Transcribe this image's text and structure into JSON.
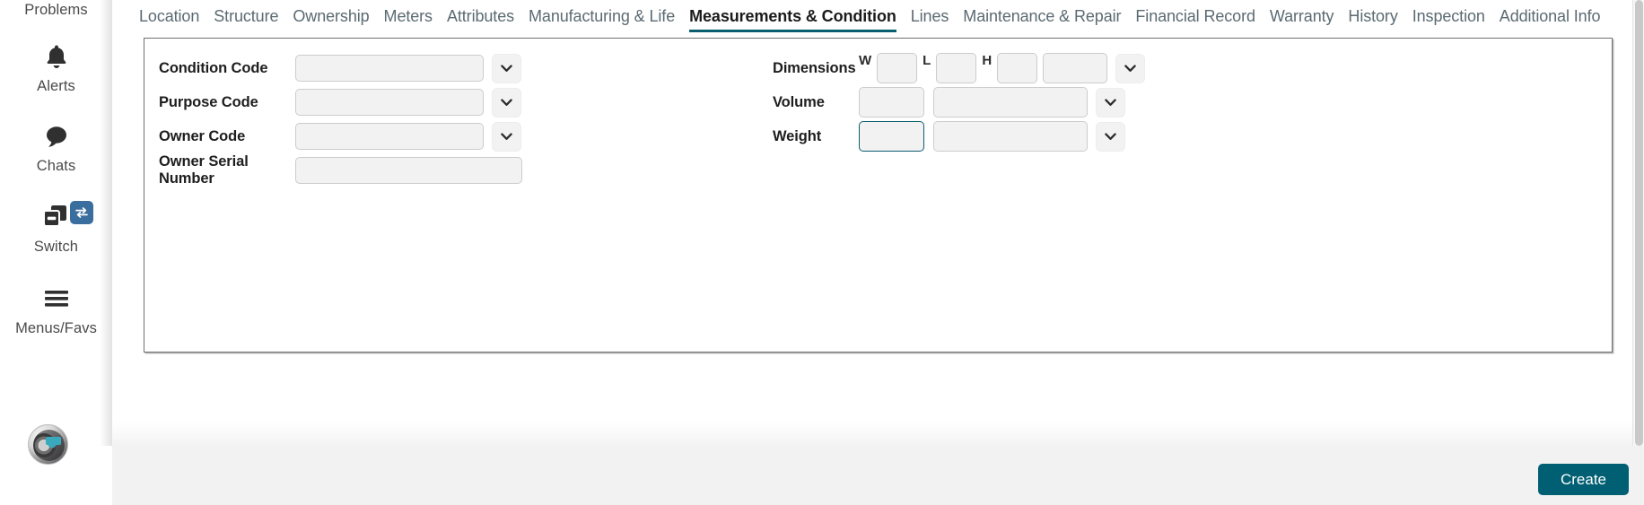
{
  "rail": {
    "items": [
      {
        "label": "Problems",
        "icon": "problems-icon"
      },
      {
        "label": "Alerts",
        "icon": "bell-icon"
      },
      {
        "label": "Chats",
        "icon": "chat-bubble-icon"
      },
      {
        "label": "Switch",
        "icon": "switch-windows-icon",
        "badge_icon": "swap-arrows-icon"
      },
      {
        "label": "Menus/Favs",
        "icon": "hamburger-menu-icon"
      }
    ],
    "avatar": {
      "name": "user-avatar",
      "alt": "AI robot head avatar"
    }
  },
  "tabs": [
    {
      "label": "Location",
      "active": false
    },
    {
      "label": "Structure",
      "active": false
    },
    {
      "label": "Ownership",
      "active": false
    },
    {
      "label": "Meters",
      "active": false
    },
    {
      "label": "Attributes",
      "active": false
    },
    {
      "label": "Manufacturing & Life",
      "active": false
    },
    {
      "label": "Measurements & Condition",
      "active": true
    },
    {
      "label": "Lines",
      "active": false
    },
    {
      "label": "Maintenance & Repair",
      "active": false
    },
    {
      "label": "Financial Record",
      "active": false
    },
    {
      "label": "Warranty",
      "active": false
    },
    {
      "label": "History",
      "active": false
    },
    {
      "label": "Inspection",
      "active": false
    },
    {
      "label": "Additional Info",
      "active": false
    }
  ],
  "form": {
    "left": {
      "condition_code": {
        "label": "Condition Code",
        "value": "",
        "placeholder": ""
      },
      "purpose_code": {
        "label": "Purpose Code",
        "value": "",
        "placeholder": ""
      },
      "owner_code": {
        "label": "Owner Code",
        "value": "",
        "placeholder": ""
      },
      "owner_serial": {
        "label": "Owner Serial Number",
        "value": "",
        "placeholder": ""
      }
    },
    "right": {
      "dimensions": {
        "label": "Dimensions",
        "w_label": "W",
        "w_value": "",
        "l_label": "L",
        "l_value": "",
        "h_label": "H",
        "h_value": "",
        "unit_value": ""
      },
      "volume": {
        "label": "Volume",
        "value": "",
        "unit_value": ""
      },
      "weight": {
        "label": "Weight",
        "value": "",
        "unit_value": "",
        "focused": true
      }
    }
  },
  "footer": {
    "create_label": "Create"
  },
  "colors": {
    "accent_teal": "#005f73",
    "tab_underline": "#0b5e70",
    "focus_border": "#0b5e70",
    "badge_blue": "#3A6E9E",
    "input_bg": "#f2f2f2",
    "footer_bg": "#f2f2f2"
  }
}
